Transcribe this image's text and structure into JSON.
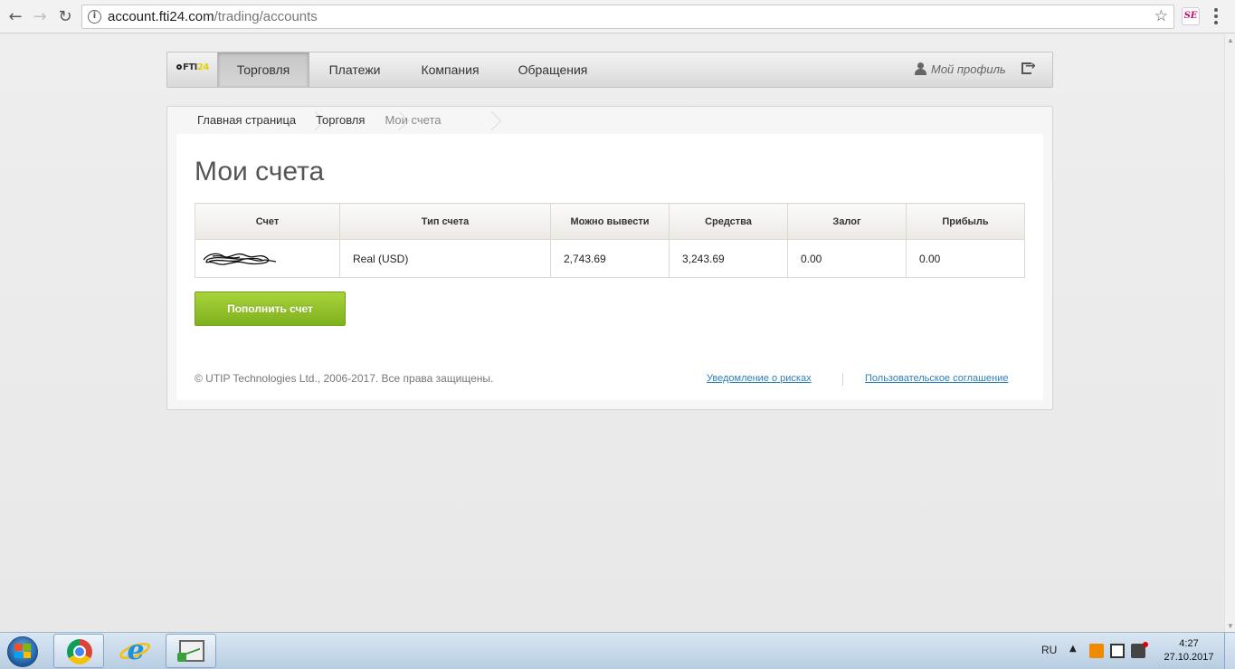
{
  "browser": {
    "back_icon": "arrow-left-icon",
    "forward_icon": "arrow-right-icon",
    "reload_icon": "reload-icon",
    "url_host": "account.fti24.com",
    "url_path": "/trading/accounts",
    "extension_label": "SE"
  },
  "site": {
    "logo_text": "FTI",
    "logo_accent": "24",
    "nav": [
      {
        "label": "Торговля",
        "active": true
      },
      {
        "label": "Платежи",
        "active": false
      },
      {
        "label": "Компания",
        "active": false
      },
      {
        "label": "Обращения",
        "active": false
      }
    ],
    "profile_label": "Мой профиль"
  },
  "breadcrumb": [
    {
      "label": "Главная страница"
    },
    {
      "label": "Торговля"
    },
    {
      "label": "Мои счета"
    }
  ],
  "page_title": "Мои счета",
  "table": {
    "headers": [
      "Счет",
      "Тип счета",
      "Можно вывести",
      "Средства",
      "Залог",
      "Прибыль"
    ],
    "rows": [
      {
        "account": "",
        "type": "Real (USD)",
        "withdrawable": "2,743.69",
        "funds": "3,243.69",
        "margin": "0.00",
        "profit": "0.00"
      }
    ]
  },
  "deposit_button": "Пополнить счет",
  "footer": {
    "copyright": "© UTIP Technologies Ltd., 2006-2017. Все права защищены.",
    "risk_link": "Уведомление о рисках",
    "agreement_link": "Пользовательское соглашение"
  },
  "taskbar": {
    "language": "RU",
    "time": "4:27",
    "date": "27.10.2017"
  },
  "colors": {
    "accent_green": "#8cc12a",
    "link_blue": "#2a7fb8",
    "logo_yellow": "#e8d100"
  }
}
